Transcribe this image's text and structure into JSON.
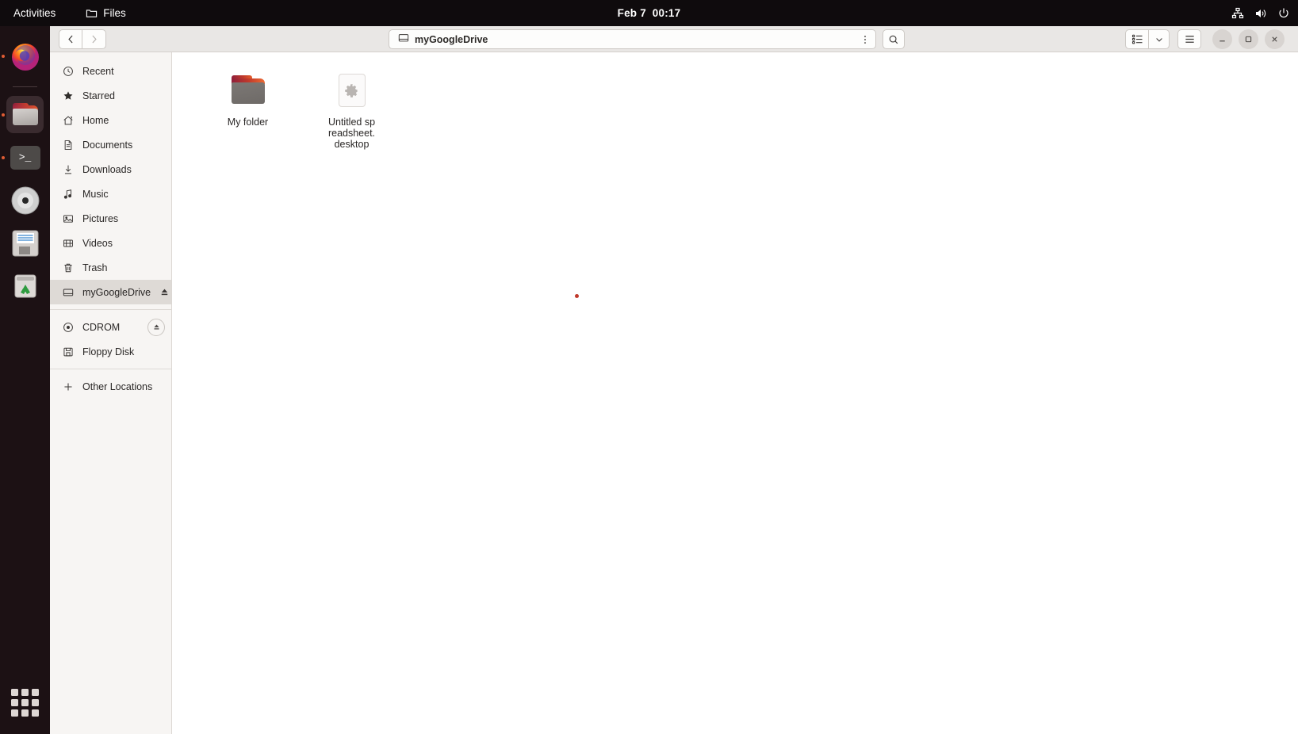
{
  "topbar": {
    "activities": "Activities",
    "app_name": "Files",
    "app_icon": "folder-icon",
    "clock": "Feb 7  00:17",
    "indicators": [
      {
        "name": "network-icon",
        "label": "Network"
      },
      {
        "name": "volume-icon",
        "label": "Volume"
      },
      {
        "name": "power-icon",
        "label": "Power"
      }
    ]
  },
  "dock": {
    "items": [
      {
        "name": "dock-item-firefox",
        "label": "Firefox",
        "running": true,
        "active": false
      },
      {
        "name": "dock-item-files",
        "label": "Files",
        "running": true,
        "active": true
      },
      {
        "name": "dock-item-terminal",
        "label": "Terminal",
        "running": true,
        "active": false
      },
      {
        "name": "dock-item-cdrom",
        "label": "CDROM",
        "running": false,
        "active": false
      },
      {
        "name": "dock-item-floppy",
        "label": "Floppy Disk",
        "running": false,
        "active": false
      },
      {
        "name": "dock-item-trash",
        "label": "Trash",
        "running": false,
        "active": false
      }
    ],
    "show_applications_label": "Show Applications"
  },
  "window": {
    "title": "myGoogleDrive",
    "headerbar": {
      "back_label": "Back",
      "forward_label": "Forward",
      "path_icon": "drive-harddisk-icon",
      "path_label": "myGoogleDrive",
      "kebab_label": "Path options",
      "search_label": "Search",
      "view_list_label": "List view",
      "view_dropdown_label": "View options",
      "menu_label": "Main menu",
      "minimize_label": "Minimize",
      "maximize_label": "Maximize",
      "close_label": "Close"
    },
    "sidebar": {
      "items": [
        {
          "name": "sidebar-item-recent",
          "label": "Recent",
          "icon": "clock-icon",
          "selected": false,
          "eject": "none"
        },
        {
          "name": "sidebar-item-starred",
          "label": "Starred",
          "icon": "star-icon",
          "selected": false,
          "eject": "none"
        },
        {
          "name": "sidebar-item-home",
          "label": "Home",
          "icon": "home-icon",
          "selected": false,
          "eject": "none"
        },
        {
          "name": "sidebar-item-documents",
          "label": "Documents",
          "icon": "document-icon",
          "selected": false,
          "eject": "none"
        },
        {
          "name": "sidebar-item-downloads",
          "label": "Downloads",
          "icon": "download-icon",
          "selected": false,
          "eject": "none"
        },
        {
          "name": "sidebar-item-music",
          "label": "Music",
          "icon": "music-note-icon",
          "selected": false,
          "eject": "none"
        },
        {
          "name": "sidebar-item-pictures",
          "label": "Pictures",
          "icon": "image-icon",
          "selected": false,
          "eject": "none"
        },
        {
          "name": "sidebar-item-videos",
          "label": "Videos",
          "icon": "video-icon",
          "selected": false,
          "eject": "none"
        },
        {
          "name": "sidebar-item-trash",
          "label": "Trash",
          "icon": "trash-icon",
          "selected": false,
          "eject": "none"
        },
        {
          "name": "sidebar-item-mygoogledrive",
          "label": "myGoogleDrive",
          "icon": "drive-harddisk-icon",
          "selected": true,
          "eject": "plain"
        }
      ],
      "devices": [
        {
          "name": "sidebar-item-cdrom",
          "label": "CDROM",
          "icon": "optical-disc-icon",
          "selected": false,
          "eject": "round"
        },
        {
          "name": "sidebar-item-floppy-disk",
          "label": "Floppy Disk",
          "icon": "floppy-icon",
          "selected": false,
          "eject": "none"
        }
      ],
      "other": {
        "name": "sidebar-item-other-locations",
        "label": "Other Locations",
        "icon": "plus-icon"
      }
    },
    "files": [
      {
        "name": "file-item-my-folder",
        "label": "My folder",
        "kind": "folder",
        "icon": "folder-icon"
      },
      {
        "name": "file-item-untitled-spreadsheet",
        "label": "Untitled spreadsheet.desktop",
        "kind": "desktop-file",
        "icon": "gear-icon"
      }
    ]
  },
  "colors": {
    "topbar_bg": "#0f0b0d",
    "dock_bg": "#1c1114",
    "headerbar_bg": "#e9e7e5",
    "sidebar_bg": "#f7f5f3",
    "selection_bg": "#dedad6",
    "accent": "#e05c34",
    "cursor_dot": "#c0392b"
  }
}
